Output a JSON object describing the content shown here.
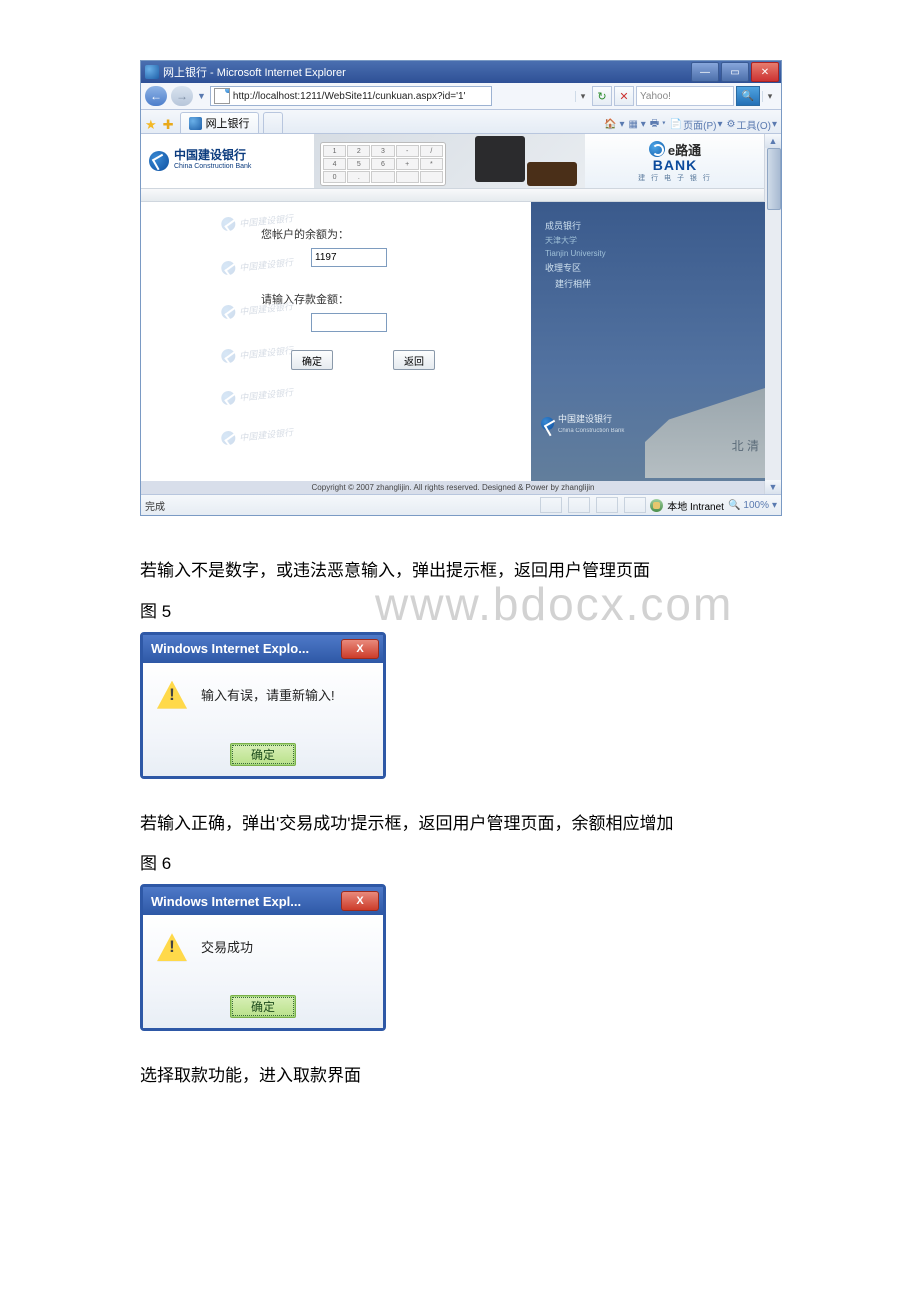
{
  "ie_window": {
    "title": "网上银行 - Microsoft Internet Explorer",
    "address": "http://localhost:1211/WebSite11/cunkuan.aspx?id='1'",
    "search_provider": "Yahoo!",
    "tab_label": "网上银行",
    "toolbar": {
      "page": "页面(P)",
      "tools": "工具(O)"
    },
    "status_left": "完成",
    "status_zone": "本地 Intranet",
    "status_zoom": "100%"
  },
  "ccb": {
    "name_cn": "中国建设银行",
    "name_en": "China Construction Bank",
    "elt_cn": "e路通",
    "elt_bank": "BANK",
    "elt_sub": "建 行 电 子 银 行",
    "wm_text": "中国建设银行"
  },
  "form": {
    "balance_label": "您帐户的余额为：",
    "balance_value": "1197",
    "amount_label": "请输入存款金额：",
    "amount_value": "",
    "btn_confirm": "确定",
    "btn_back": "返回"
  },
  "right_panel": {
    "l1": "成员银行",
    "l2_en": "Tianjin University",
    "l2_cn": "天津大学",
    "l3": "收理专区",
    "l4": "建行相伴",
    "bottom_name": "中国建设银行",
    "bottom_en": "China Construction Bank",
    "char": "北 清"
  },
  "footer": "Copyright © 2007 zhanglijin. All rights reserved. Designed & Power by zhanglijin",
  "doc": {
    "watermark": "www.bdocx.com",
    "desc1": "若输入不是数字，或违法恶意输入，弹出提示框，返回用户管理页面",
    "fig5": "图 5",
    "dlg1_title": "Windows Internet Explo...",
    "dlg1_msg": "输入有误，请重新输入!",
    "dlg1_btn": "确定",
    "desc2": "若输入正确，弹出'交易成功'提示框，返回用户管理页面，余额相应增加",
    "fig6": "图 6",
    "dlg2_title": "Windows Internet Expl...",
    "dlg2_msg": "交易成功",
    "dlg2_btn": "确定",
    "desc3": "选择取款功能，进入取款界面"
  }
}
